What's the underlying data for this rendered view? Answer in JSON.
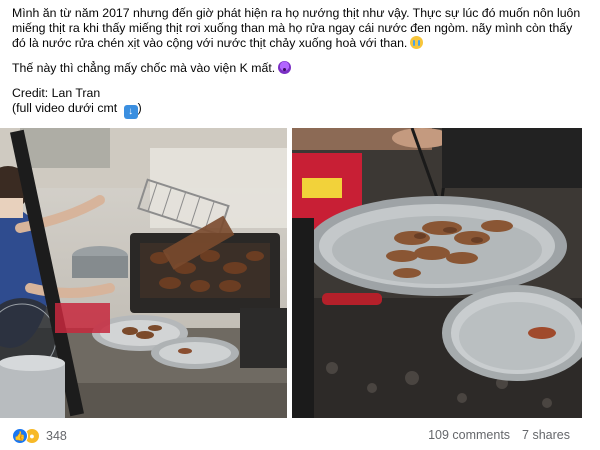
{
  "post": {
    "paragraph1": "Mình ăn từ năm 2017 nhưng đến giờ phát hiện ra họ nướng thịt như vậy. Thực sự lúc đó muốn nôn luôn miếng thịt ra khi thấy miếng thịt rơi xuống than mà họ rửa ngay cái nước đen ngòm. nãy mình còn thấy đó là nước rửa chén xịt vào cộng với nước thịt chảy xuống hoà với than.",
    "paragraph2": "Thế này thì chẳng mấy chốc mà vào viện K mất.",
    "credit": "Credit: Lan Tran",
    "full_video": "(full video dưới cmt",
    "full_video_close": ")"
  },
  "emojis": {
    "p1_end": "crying-face-icon",
    "p2_end": "astonished-face-icon",
    "video": "down-arrow-icon"
  },
  "footer": {
    "reaction_count": "348",
    "comments": "109 comments",
    "shares": "7 shares"
  },
  "colors": {
    "text": "#050505",
    "meta": "#65676b",
    "like": "#1877f2",
    "care": "#f7b928"
  }
}
